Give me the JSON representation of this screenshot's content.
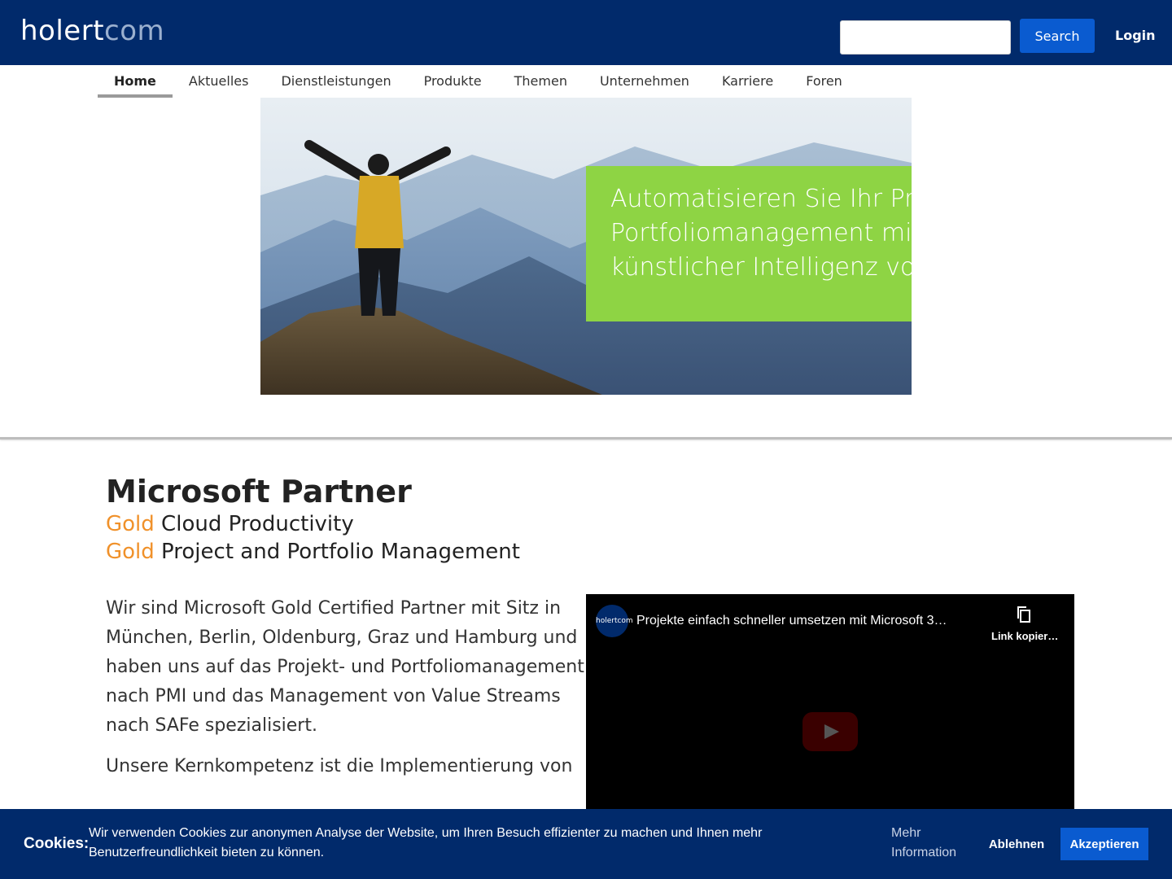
{
  "header": {
    "logo_part1": "holert",
    "logo_part2": "com",
    "search_value": "",
    "search_button": "Search",
    "login": "Login"
  },
  "nav": {
    "items": [
      "Home",
      "Aktuelles",
      "Dienstleistungen",
      "Produkte",
      "Themen",
      "Unternehmen",
      "Karriere",
      "Foren"
    ],
    "active": "Home"
  },
  "hero": {
    "lines": [
      "Automatisieren Sie Ihr Projek",
      "Portfoliomanagement mit Co",
      "künstlicher Intelligenz von M"
    ]
  },
  "partner": {
    "title": "Microsoft Partner",
    "gold_word": "Gold",
    "line1": " Cloud Productivity",
    "line2": " Project and Portfolio Management"
  },
  "body": {
    "p1": "Wir sind Microsoft Gold Certified Partner mit Sitz in München, Berlin, Oldenburg, Graz und Hamburg und haben uns auf das Projekt- und Portfoliomanagement nach PMI und das Management von Value Streams nach SAFe spezialisiert.",
    "p2": "Unsere Kernkompetenz ist die Implementierung von"
  },
  "video": {
    "channel": "holertcom",
    "title": "Projekte einfach schneller umsetzen mit Microsoft 3…",
    "copy_link": "Link kopier…"
  },
  "cookie": {
    "label": "Cookies:",
    "text": "Wir verwenden Cookies zur anonymen Analyse der Website, um Ihren Besuch effizienter zu machen und Ihnen mehr Benutzerfreundlichkeit bieten zu können.",
    "more": "Mehr Information",
    "decline": "Ablehnen",
    "accept": "Akzeptieren"
  },
  "colors": {
    "header_bg": "#012a6b",
    "primary_button": "#0a5bd0",
    "hero_box": "#8ed444",
    "gold_text": "#f0912a"
  }
}
